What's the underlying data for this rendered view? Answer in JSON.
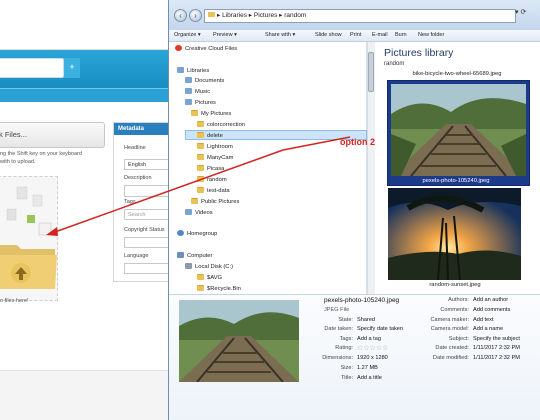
{
  "webpage": {
    "add_files_label": "k Files...",
    "hint_line1": "ng the Shift key on your keyboard",
    "hint_line2": "with to upload.",
    "drop_text": "o files here!",
    "metadata": {
      "header": "Metadata",
      "headline_label": "Headline",
      "language_value": "English",
      "description_label": "Description",
      "tags_label": "Tags",
      "tags_placeholder": "Search",
      "copyright_label": "Copyright Status",
      "language_label": "Language"
    }
  },
  "explorer": {
    "address": "▸ Libraries ▸ Pictures ▸ random",
    "toolbar": [
      "Organize ▾",
      "Preview ▾",
      "Share with ▾",
      "Slide show",
      "Print",
      "E-mail",
      "Burn",
      "New folder"
    ],
    "nav_items": [
      {
        "label": "Creative Cloud Files",
        "icon": "cc"
      },
      {
        "label": "Libraries",
        "icon": "lib"
      },
      {
        "label": "Documents",
        "icon": "lib"
      },
      {
        "label": "Music",
        "icon": "lib"
      },
      {
        "label": "Pictures",
        "icon": "lib"
      },
      {
        "label": "My Pictures",
        "icon": "folder"
      },
      {
        "label": "colorcorrection",
        "icon": "folder"
      },
      {
        "label": "delete",
        "icon": "folder"
      },
      {
        "label": "Lightroom",
        "icon": "folder"
      },
      {
        "label": "ManyCam",
        "icon": "folder"
      },
      {
        "label": "Picasa",
        "icon": "folder"
      },
      {
        "label": "random",
        "icon": "folder"
      },
      {
        "label": "test-data",
        "icon": "folder"
      },
      {
        "label": "Public Pictures",
        "icon": "folder"
      },
      {
        "label": "Videos",
        "icon": "lib"
      },
      {
        "label": "Homegroup",
        "icon": "net"
      },
      {
        "label": "Computer",
        "icon": "computer"
      },
      {
        "label": "Local Disk (C:)",
        "icon": "disk"
      },
      {
        "label": "$AVG",
        "icon": "folder"
      },
      {
        "label": "$Recycle.Bin",
        "icon": "folder"
      }
    ],
    "library_title": "Pictures library",
    "library_subtitle": "random",
    "thumb_top_caption": "bike-bicycle-two-wheel-65689.jpeg",
    "thumb1_caption": "pexels-photo-105240.jpeg",
    "thumb2_caption": "random-sunset.jpeg",
    "details": {
      "filename": "pexels-photo-105240.jpeg",
      "filetype": "JPEG File",
      "state_label": "State:",
      "state_value": "Shared",
      "date_taken_label": "Date taken:",
      "date_taken_value": "Specify date taken",
      "tags_label": "Tags:",
      "tags_value": "Add a tag",
      "rating_label": "Rating:",
      "rating_value": "☆☆☆☆☆",
      "dimensions_label": "Dimensions:",
      "dimensions_value": "1920 x 1280",
      "size_label": "Size:",
      "size_value": "1.27 MB",
      "title_label": "Title:",
      "title_value": "Add a title",
      "authors_label": "Authors:",
      "authors_value": "Add an author",
      "comments_label": "Comments:",
      "comments_value": "Add comments",
      "camera_maker_label": "Camera maker:",
      "camera_maker_value": "Add text",
      "camera_model_label": "Camera model:",
      "camera_model_value": "Add a name",
      "subject_label": "Subject:",
      "subject_value": "Specify the subject",
      "date_created_label": "Date created:",
      "date_created_value": "1/11/2017 2:32 PM",
      "date_modified_label": "Date modified:",
      "date_modified_value": "1/11/2017 2:32 PM"
    }
  },
  "annotation": {
    "label": "option 2",
    "color": "#d4241f"
  }
}
